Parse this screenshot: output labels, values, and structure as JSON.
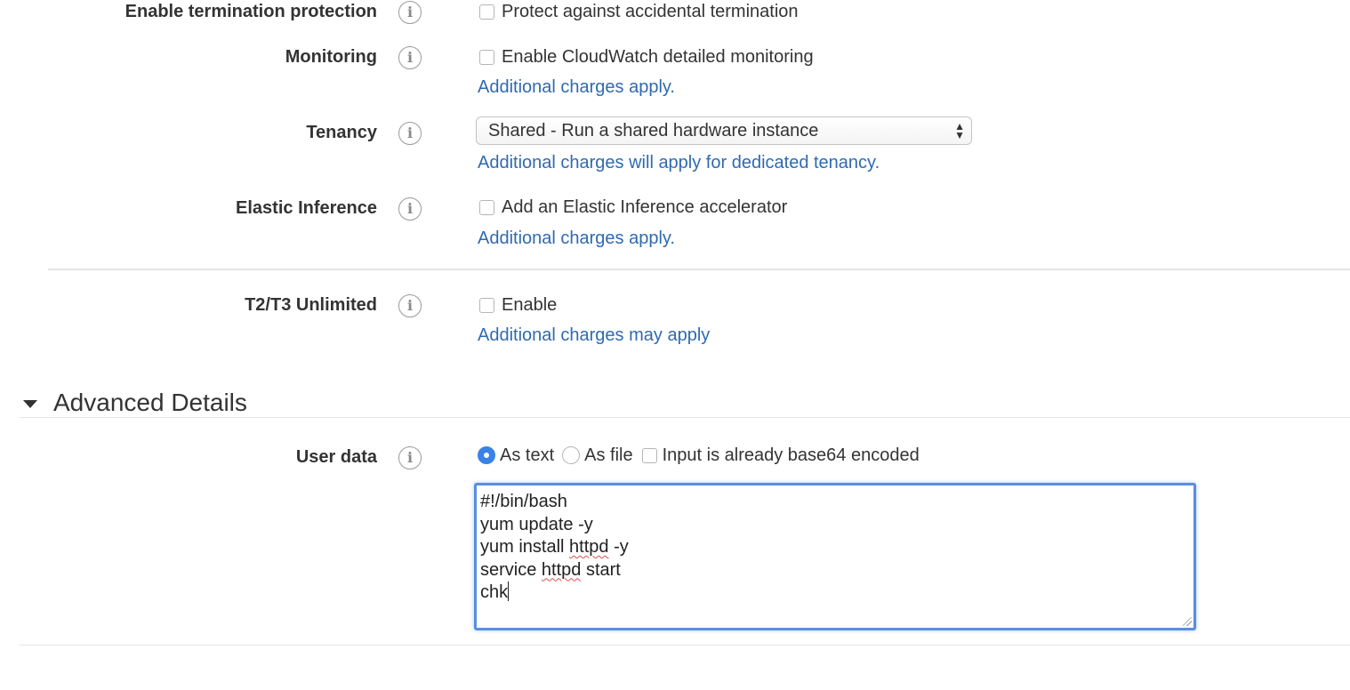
{
  "settings": {
    "termination": {
      "label": "Enable termination protection",
      "checkbox_label": "Protect against accidental termination"
    },
    "monitoring": {
      "label": "Monitoring",
      "checkbox_label": "Enable CloudWatch detailed monitoring",
      "note": "Additional charges apply."
    },
    "tenancy": {
      "label": "Tenancy",
      "selected": "Shared - Run a shared hardware instance",
      "note": "Additional charges will apply for dedicated tenancy."
    },
    "elastic_inference": {
      "label": "Elastic Inference",
      "checkbox_label": "Add an Elastic Inference accelerator",
      "note": "Additional charges apply."
    },
    "unlimited": {
      "label": "T2/T3 Unlimited",
      "checkbox_label": "Enable",
      "note": "Additional charges may apply"
    }
  },
  "advanced": {
    "title": "Advanced Details",
    "user_data": {
      "label": "User data",
      "option_text": "As text",
      "option_file": "As file",
      "base64_label": "Input is already base64 encoded",
      "selected_option": "As text",
      "lines": {
        "l1": "#!/bin/bash",
        "l2": "yum update -y",
        "l3a": "yum install ",
        "l3b": "httpd",
        "l3c": " -y",
        "l4a": "service ",
        "l4b": "httpd",
        "l4c": " start",
        "l5": "chk"
      }
    }
  },
  "icons": {
    "info": "i",
    "info_icon_name": "info-icon",
    "select_arrows": "select-arrows-icon"
  },
  "colors": {
    "link": "#2f6ab0",
    "focus": "#5a8ee0",
    "radio_selected": "#3b82e6"
  }
}
